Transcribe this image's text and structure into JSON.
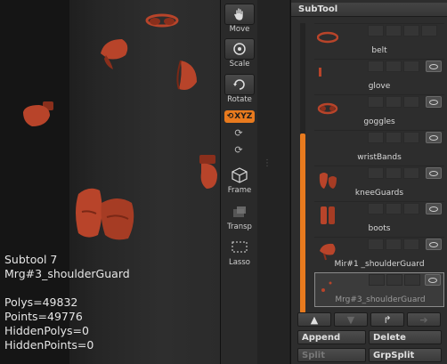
{
  "viewport": {
    "info_lines": [
      "Subtool 7",
      "Mrg#3_shoulderGuard"
    ],
    "stats": [
      "Polys=49832",
      "Points=49776",
      "HiddenPolys=0",
      "HiddenPoints=0"
    ]
  },
  "tools": [
    {
      "label": "Move",
      "icon": "move-hand-icon"
    },
    {
      "label": "Scale",
      "icon": "scale-icon"
    },
    {
      "label": "Rotate",
      "icon": "rotate-icon"
    },
    {
      "label": "Frame",
      "icon": "frame-cube-icon"
    },
    {
      "label": "Transp",
      "icon": "transparency-icon"
    },
    {
      "label": "Lasso",
      "icon": "lasso-icon"
    }
  ],
  "xyz_label": "XYZ",
  "panel": {
    "title": "SubTool",
    "items": [
      {
        "name": "belt"
      },
      {
        "name": "glove"
      },
      {
        "name": "goggles"
      },
      {
        "name": "wristBands"
      },
      {
        "name": "kneeGuards"
      },
      {
        "name": "boots"
      },
      {
        "name": "Mir#1 _shoulderGuard"
      },
      {
        "name": "Mrg#3_shoulderGuard",
        "selected": true
      }
    ],
    "buttons": {
      "append": "Append",
      "delete": "Delete",
      "split": "Split",
      "grpsplit": "GrpSplit"
    }
  },
  "colors": {
    "accent": "#e87a1e",
    "model": "#b8442a"
  }
}
